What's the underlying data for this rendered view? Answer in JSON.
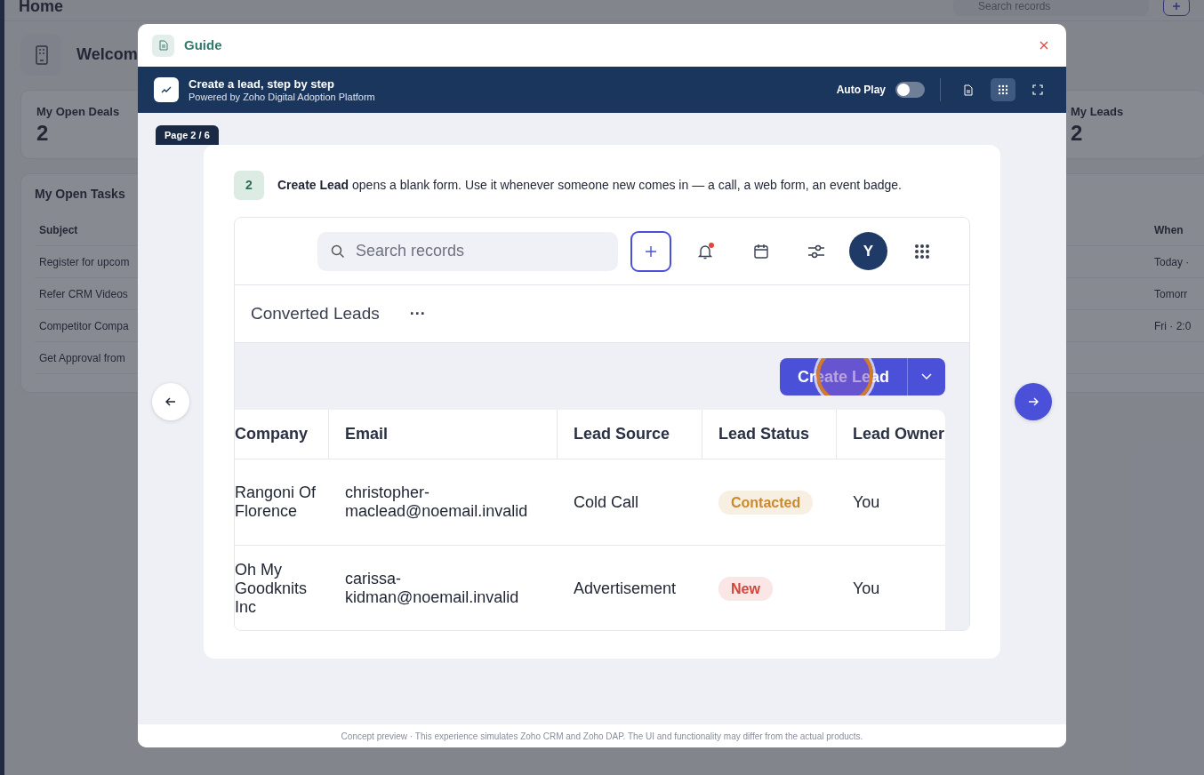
{
  "background": {
    "page_title": "Home",
    "search": {
      "placeholder": "Search records"
    },
    "welcome": "Welcom",
    "stats": [
      {
        "label": "My Open Deals",
        "value": "2"
      },
      {
        "label": "My Leads",
        "value": "2"
      }
    ],
    "tasks": {
      "title": "My Open Tasks",
      "columns": [
        "Subject",
        "When"
      ],
      "rows": [
        {
          "subject": "Register for upcom",
          "when": "Today ·"
        },
        {
          "subject": "Refer CRM Videos",
          "when": "Tomorr"
        },
        {
          "subject": "Competitor Compa",
          "when": "Fri · 2:0"
        },
        {
          "subject": "Get Approval from"
        }
      ]
    }
  },
  "modal": {
    "title": "Guide",
    "tour": {
      "title": "Create a lead, step by step",
      "subtitle": "Powered by Zoho Digital Adoption Platform"
    },
    "autoplay": {
      "label": "Auto Play",
      "on": false
    },
    "views": [
      {
        "kind": "document",
        "selected": false
      },
      {
        "kind": "grid",
        "selected": true
      },
      {
        "kind": "fullscreen",
        "selected": false
      }
    ],
    "page": "Page 2 / 6",
    "step": {
      "number": "2",
      "text": "**Create Lead** opens a blank form. Use it whenever someone new comes in — a call, a web form, an event badge."
    },
    "preview": {
      "search": {
        "placeholder": "Search records"
      },
      "unread": true,
      "avatar": "Y",
      "view_title": "Converted Leads",
      "more": "···",
      "create_button": "Create Lead",
      "table": {
        "columns": [
          "Company",
          "Email",
          "Lead Source",
          "Lead Status",
          "Lead Owner"
        ],
        "rows": [
          {
            "company": "Rangoni Of Florence",
            "email": "christopher-maclead@noemail.invalid",
            "source": "Cold Call",
            "status": {
              "label": "Contacted",
              "color": "#c98a2e"
            },
            "owner": "You"
          },
          {
            "company": "Oh My Goodknits Inc",
            "email": "carissa-kidman@noemail.invalid",
            "source": "Advertisement",
            "status": {
              "label": "New",
              "color": "#d2453a"
            },
            "owner": "You"
          }
        ]
      }
    },
    "footer": "Concept preview · This experience simulates Zoho CRM and Zoho DAP. The UI and functionality may differ from the actual products."
  }
}
